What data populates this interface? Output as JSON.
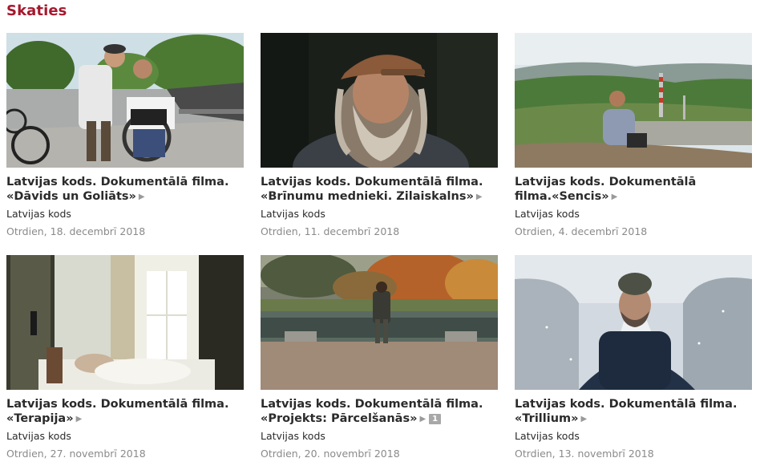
{
  "section": {
    "title": "Skaties",
    "accent_color": "#a6192e"
  },
  "cards": [
    {
      "title": "Latvijas kods. Dokumentālā filma. «Dāvids un Goliāts»",
      "category": "Latvijas kods",
      "date": "Otrdien, 18. decembrī 2018",
      "thumb": "skatepark-two-young-men-wheelchair"
    },
    {
      "title": "Latvijas kods. Dokumentālā filma. «Brīnumu mednieki. Zilaiskalns»",
      "category": "Latvijas kods",
      "date": "Otrdien, 11. decembrī 2018",
      "thumb": "old-bearded-man-cap-portrait"
    },
    {
      "title": "Latvijas kods. Dokumentālā filma.«Sencis»",
      "category": "Latvijas kods",
      "date": "Otrdien, 4. decembrī 2018",
      "thumb": "man-sitting-on-hill-overlooking-town"
    },
    {
      "title": "Latvijas kods. Dokumentālā filma. «Terapija»",
      "category": "Latvijas kods",
      "date": "Otrdien, 27. novembrī 2018",
      "thumb": "person-lying-in-bed-window"
    },
    {
      "title": "Latvijas kods. Dokumentālā filma. «Projekts: Pārcelšanās»",
      "category": "Latvijas kods",
      "date": "Otrdien, 20. novembrī 2018",
      "thumb": "man-standing-by-pond-autumn",
      "badge": "1"
    },
    {
      "title": "Latvijas kods. Dokumentālā filma. «Trillium»",
      "category": "Latvijas kods",
      "date": "Otrdien, 13. novembrī 2018",
      "thumb": "man-in-beanie-snowy-road"
    }
  ]
}
